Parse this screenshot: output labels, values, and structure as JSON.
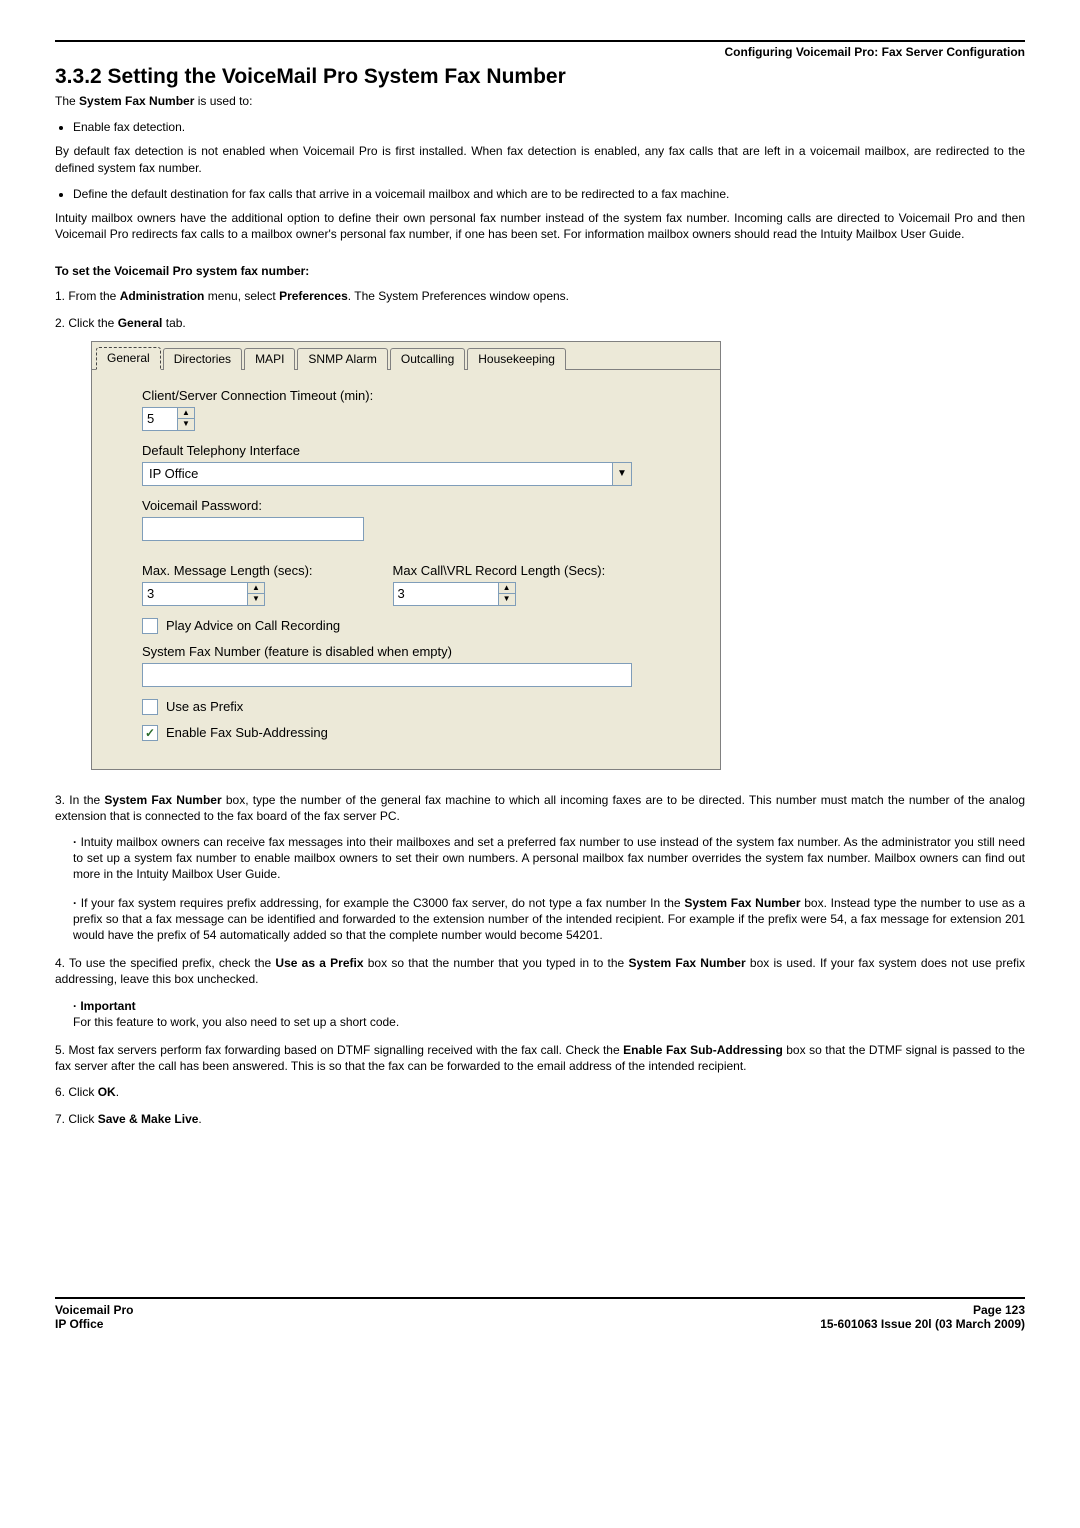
{
  "header": {
    "category": "Configuring Voicemail Pro: Fax Server Configuration"
  },
  "heading": "3.3.2 Setting the VoiceMail Pro System Fax Number",
  "intro": {
    "lead": "The System Fax Number is used to:",
    "bullet1": "Enable fax detection.",
    "para1": "By default fax detection is not enabled when Voicemail Pro is first installed. When fax detection is enabled, any fax calls that are left in a voicemail mailbox, are redirected to the defined system fax number.",
    "bullet2": "Define the default destination for fax calls that arrive in a voicemail mailbox and which are to be redirected to a fax machine.",
    "para2": "Intuity mailbox owners have the additional option to define their own personal fax number instead of the system fax number. Incoming calls are directed to Voicemail Pro and then Voicemail Pro redirects fax calls to a mailbox owner's personal fax number, if one has been set. For information mailbox owners should read the Intuity Mailbox User Guide."
  },
  "procedure_title": "To set the Voicemail Pro system fax number:",
  "steps": {
    "s1": "1. From the Administration menu, select Preferences. The System Preferences window opens.",
    "s2": "2. Click the General tab.",
    "s3_lead": "3. In the System Fax Number box, type the number of the general fax machine to which all incoming faxes are to be directed. This number must match the number of the analog extension that is connected to the fax board of the fax server PC.",
    "s3_sub1": "Intuity mailbox owners can receive fax messages into their mailboxes and set a preferred fax number to use instead of the system fax number. As the administrator you still need to set up a system fax number to enable mailbox owners to set their own numbers. A personal mailbox fax number overrides the system fax number. Mailbox owners can find out more in the Intuity Mailbox User Guide.",
    "s3_sub2": "If your fax system requires prefix addressing, for example the C3000 fax server, do not type a fax number In the System Fax Number box. Instead type the number to use as a prefix so that a fax message can be identified and forwarded to the extension number of the intended recipient. For example if the prefix were 54, a fax message for extension 201 would have the prefix of 54 automatically added so that the complete number would become 54201.",
    "s4": "4. To use the specified prefix, check the Use as a Prefix box so that the number that you typed in to the System Fax Number box is used. If your fax system does not use prefix addressing, leave this box unchecked.",
    "s4_sub_label": "Important",
    "s4_sub_text": "For this feature to work, you also need to set up a short code.",
    "s5": "5. Most fax servers perform fax forwarding based on DTMF signalling received with the fax call. Check the Enable Fax Sub-Addressing box so that the DTMF signal is passed to the fax server after the call has been answered. This is so that the fax can be forwarded to the email address of the intended recipient.",
    "s6": "6. Click OK.",
    "s7": "7. Click Save & Make Live."
  },
  "dialog": {
    "tabs": {
      "general": "General",
      "directories": "Directories",
      "mapi": "MAPI",
      "snmp": "SNMP Alarm",
      "outcalling": "Outcalling",
      "housekeeping": "Housekeeping"
    },
    "client_timeout_label": "Client/Server Connection Timeout (min):",
    "client_timeout_value": "5",
    "telephony_label": "Default Telephony Interface",
    "telephony_value": "IP Office",
    "vm_password_label": "Voicemail Password:",
    "max_msg_label": "Max. Message Length (secs):",
    "max_msg_value": "3",
    "max_vrl_label": "Max Call\\VRL Record Length (Secs):",
    "max_vrl_value": "3",
    "play_advice_label": "Play Advice on Call Recording",
    "sys_fax_label": "System Fax Number (feature is disabled when empty)",
    "use_prefix_label": "Use as Prefix",
    "enable_fax_label": "Enable Fax Sub-Addressing"
  },
  "footer": {
    "left1": "Voicemail Pro",
    "left2": "IP Office",
    "right1": "Page 123",
    "right2": "15-601063 Issue 20l (03 March 2009)"
  }
}
